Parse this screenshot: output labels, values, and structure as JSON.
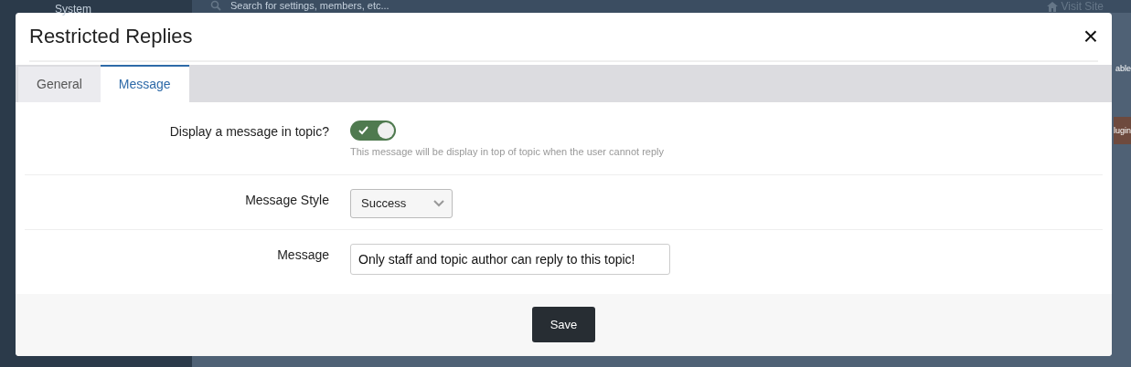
{
  "background": {
    "sidebar_title": "System",
    "search": {
      "placeholder": "Search for settings, members, etc..."
    },
    "visit_site": "Visit Site",
    "side_texts": [
      {
        "kind": "text",
        "label": "able"
      },
      {
        "kind": "button",
        "label": "lugin"
      }
    ]
  },
  "dialog": {
    "title": "Restricted Replies",
    "close": "×",
    "tabs": [
      {
        "label": "General",
        "selected": false
      },
      {
        "label": "Message",
        "selected": true
      }
    ],
    "fields": [
      {
        "kind": "toggle",
        "label": "Display a message in topic?",
        "on": true,
        "hint": "This message will be display in top of topic when the user cannot reply"
      },
      {
        "kind": "select",
        "label": "Message Style",
        "value": "Success"
      },
      {
        "kind": "text",
        "label": "Message",
        "value": "Only staff and topic author can reply to this topic!"
      }
    ],
    "save": "Save"
  }
}
